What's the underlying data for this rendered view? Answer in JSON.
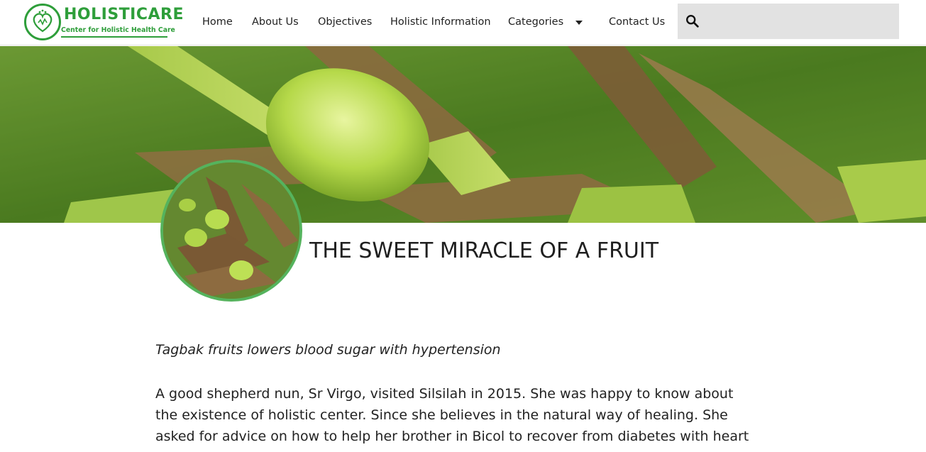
{
  "header": {
    "logo": {
      "name": "HOLISTICARE",
      "tagline": "Center for Holistic Health Care"
    },
    "nav": [
      {
        "label": "Home"
      },
      {
        "label": "About Us"
      },
      {
        "label": "Objectives"
      },
      {
        "label": "Holistic Information"
      },
      {
        "label": "Categories"
      },
      {
        "label": "Contact Us"
      }
    ],
    "search": {
      "placeholder": "",
      "icon": "search-icon"
    }
  },
  "article": {
    "title": "THE SWEET MIRACLE OF A FRUIT",
    "subtitle": "Tagbak fruits lowers blood sugar with hypertension",
    "body": "A good shepherd nun, Sr Virgo, visited Silsilah in 2015. She was happy to know about the existence of holistic center. Since she believes in the natural way of healing. She asked for advice on how to help her brother in Bicol to recover from diabetes with heart problem."
  },
  "colors": {
    "brand": "#2e9e3a",
    "avatar_border": "#55b35d",
    "search_bg": "#e2e2e2"
  }
}
